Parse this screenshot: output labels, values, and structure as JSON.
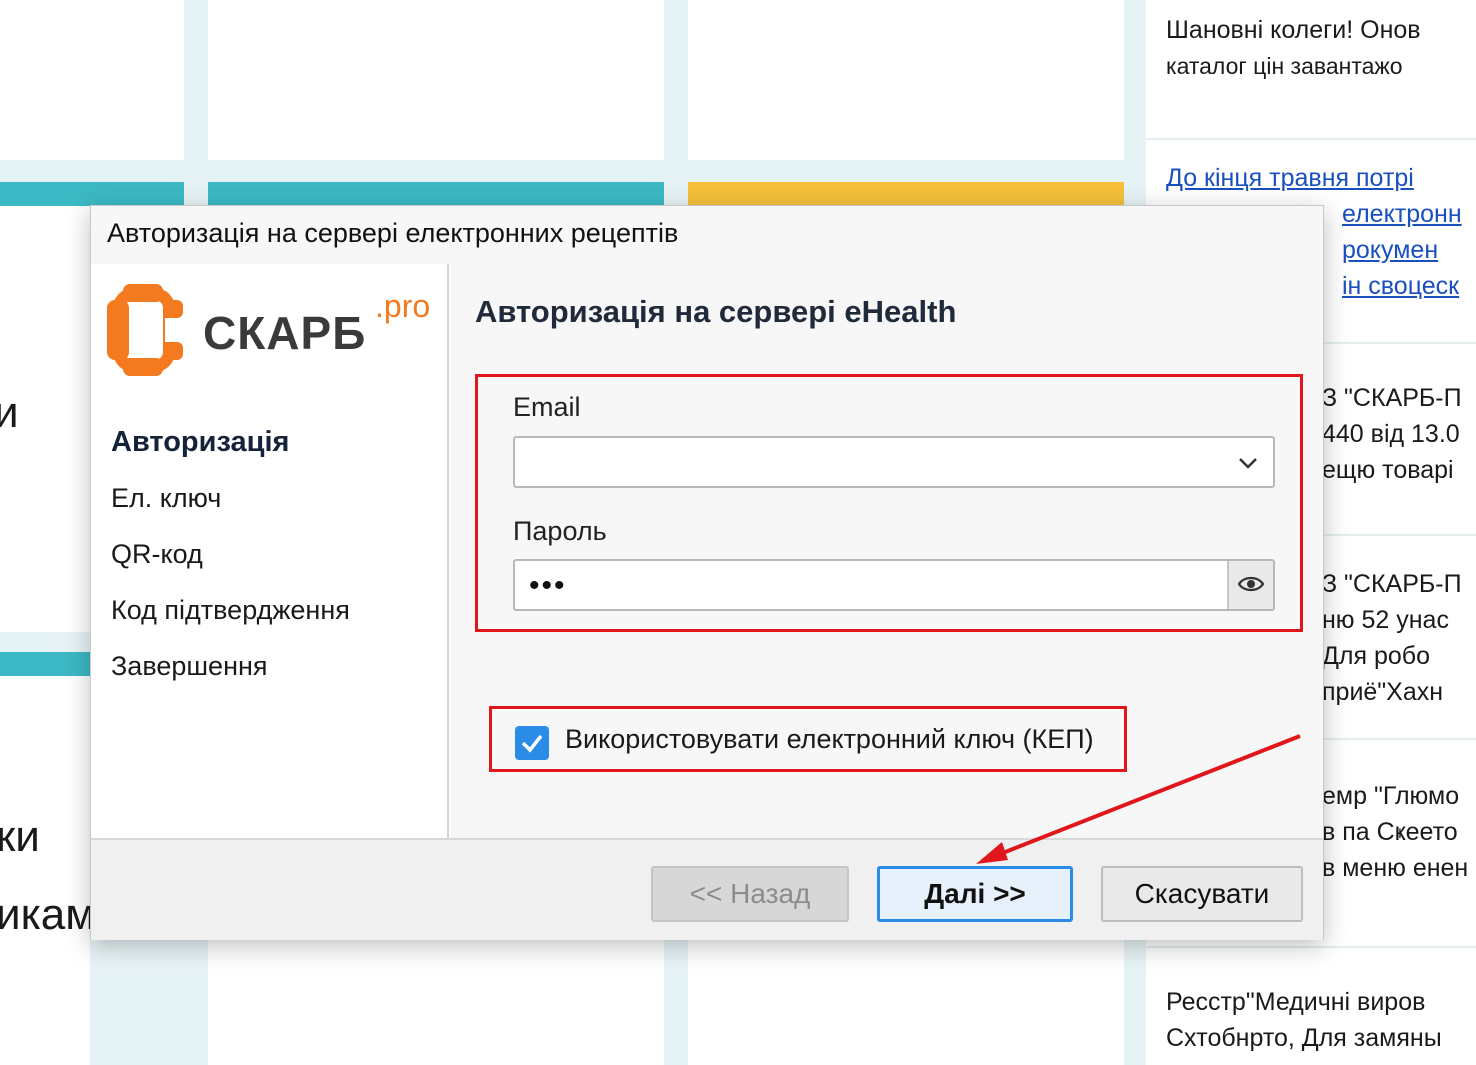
{
  "background": {
    "news": [
      {
        "line1": "Шановні колеги! Онов",
        "line2": "каталог цін завантажо"
      },
      {
        "link1": "До кінця травня потрі",
        "link2": "електронн",
        "link3": "рокумен",
        "link4": "ін своцеск"
      },
      {
        "line1": "З \"СКАРБ-П",
        "line2": "440 від 13.0",
        "line3": "ещю товарі"
      },
      {
        "line1": "З \"СКАРБ-П",
        "line2": "ню 52 унас",
        "line3": "Для робо",
        "line4": "приё\"Хахн"
      },
      {
        "line1": "емр \"Глюмо",
        "line2": "в па Сҝеето",
        "line3": "в меню енен"
      },
      {
        "line1": "Ресстр\"Медичні виров",
        "line2": "Схтобнрто, Для замяны"
      }
    ],
    "left_fragments": [
      "и",
      "ки",
      "икам"
    ]
  },
  "dialog": {
    "title": "Авторизація на сервері електронних рецептів",
    "logo": {
      "name": "СКАРБ",
      "suffix": ".pro"
    },
    "steps": [
      "Авторизація",
      "Ел. ключ",
      "QR-код",
      "Код підтвердження",
      "Завершення"
    ],
    "section_title": "Авторизація на сервері eHealth",
    "email": {
      "label": "Email",
      "value": ""
    },
    "password": {
      "label": "Пароль",
      "value": "•••"
    },
    "use_key": {
      "label": "Використовувати електронний ключ (КЕП)",
      "checked": true
    },
    "buttons": {
      "back": "<< Назад",
      "next": "Далі >>",
      "cancel": "Скасувати"
    }
  },
  "colors": {
    "brand_orange": "#f47a1f",
    "accent_blue": "#2a8ce6",
    "highlight_red": "#e0161c"
  }
}
